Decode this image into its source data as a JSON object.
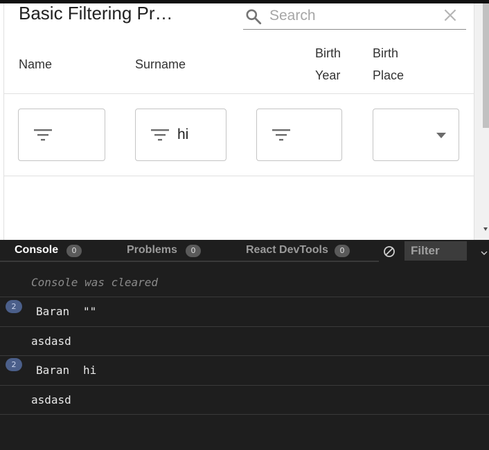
{
  "table": {
    "title": "Basic Filtering Pr…",
    "search": {
      "placeholder": "Search",
      "value": ""
    },
    "columns": {
      "name": "Name",
      "surname": "Surname",
      "birth_year_line1": "Birth",
      "birth_year_line2": "Year",
      "birth_place_line1": "Birth",
      "birth_place_line2": "Place"
    },
    "filters": {
      "name": "",
      "surname": "hi",
      "birth_year": "",
      "birth_place": ""
    }
  },
  "devtools": {
    "tabs": [
      {
        "label": "Console",
        "badge": "0",
        "active": true
      },
      {
        "label": "Problems",
        "badge": "0",
        "active": false
      },
      {
        "label": "React DevTools",
        "badge": "0",
        "active": false
      }
    ],
    "filter_placeholder": "Filter",
    "logs": [
      {
        "text": "Console was cleared"
      },
      {
        "count": "2",
        "args": [
          "Baran",
          "\"\""
        ]
      },
      {
        "text": "asdasd"
      },
      {
        "count": "2",
        "args": [
          "Baran",
          "hi"
        ]
      },
      {
        "text": "asdasd"
      }
    ]
  },
  "colors": {
    "devtools_bg": "#1e1e1e",
    "badge_blue": "#4b5f8a",
    "filter_bg": "#3c3c3c"
  },
  "icons": [
    "search-icon",
    "close-icon",
    "filter-list-icon",
    "dropdown-arrow-icon",
    "clear-console-icon",
    "chevron-down-icon",
    "prompt-icon"
  ]
}
